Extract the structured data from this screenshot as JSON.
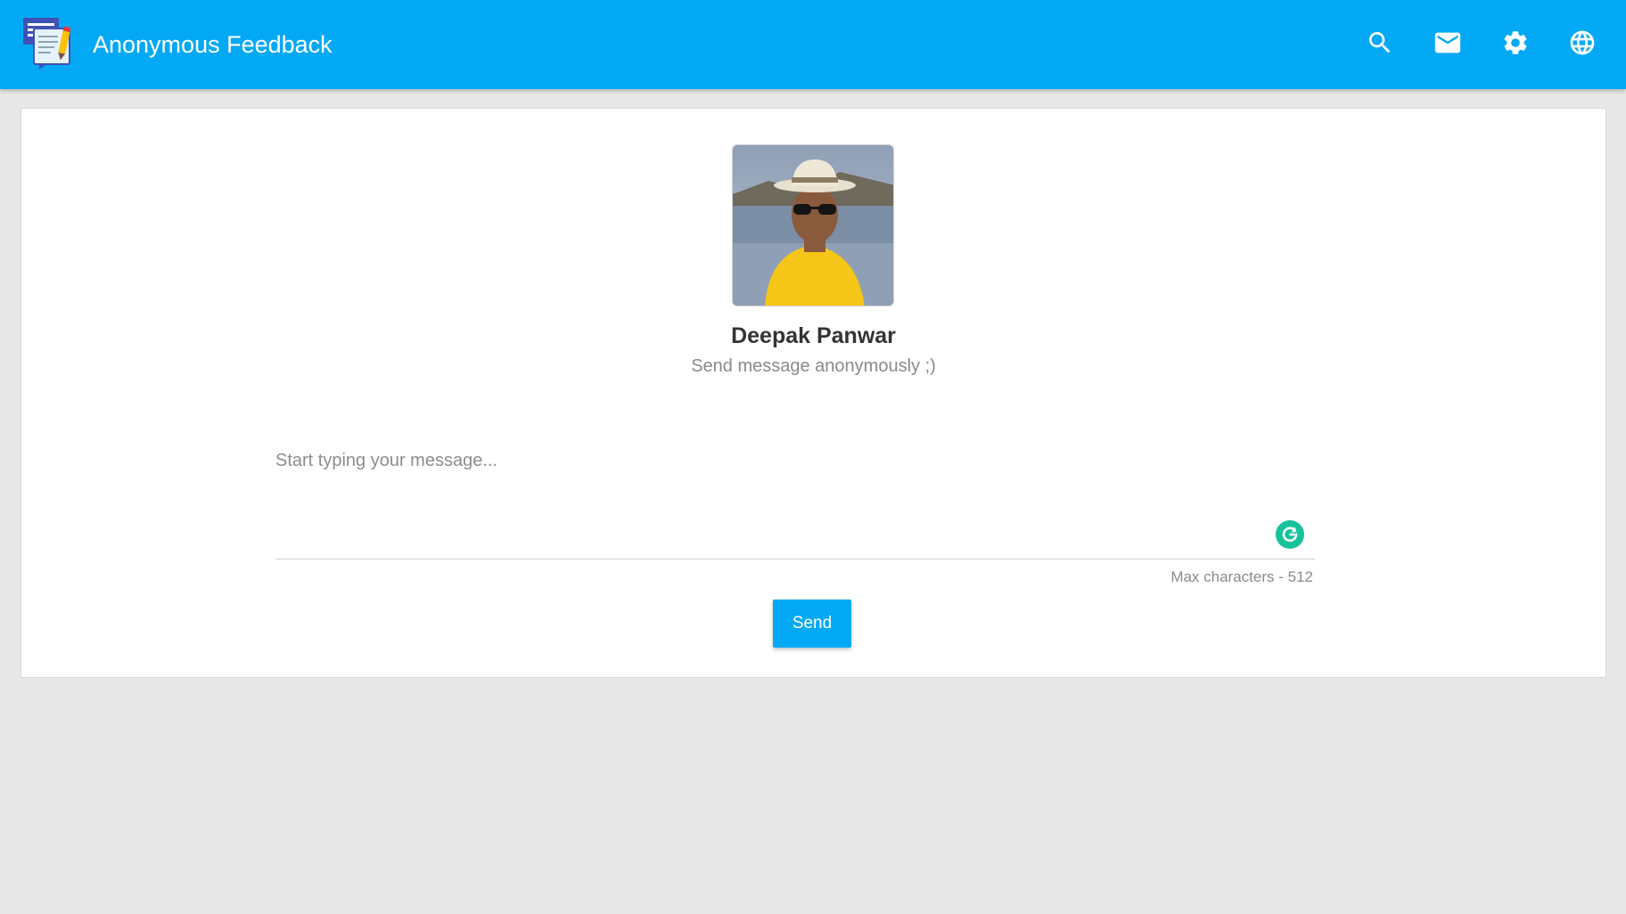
{
  "app": {
    "title": "Anonymous Feedback",
    "logo_icon": "chat-document-logo"
  },
  "toolbar": {
    "actions": [
      {
        "icon": "search-icon",
        "label": "Search"
      },
      {
        "icon": "mail-icon",
        "label": "Inbox"
      },
      {
        "icon": "gear-icon",
        "label": "Settings"
      },
      {
        "icon": "globe-icon",
        "label": "Language"
      }
    ]
  },
  "profile": {
    "name": "Deepak Panwar",
    "subtitle": "Send message anonymously ;)",
    "avatar_alt": "profile-photo"
  },
  "message": {
    "placeholder": "Start typing your message...",
    "value": "",
    "max_chars_label": "Max characters - 512"
  },
  "send_label": "Send",
  "colors": {
    "primary": "#03a9f4",
    "background": "#e8e8e8",
    "card": "#ffffff",
    "grammarly": "#15c39a"
  }
}
